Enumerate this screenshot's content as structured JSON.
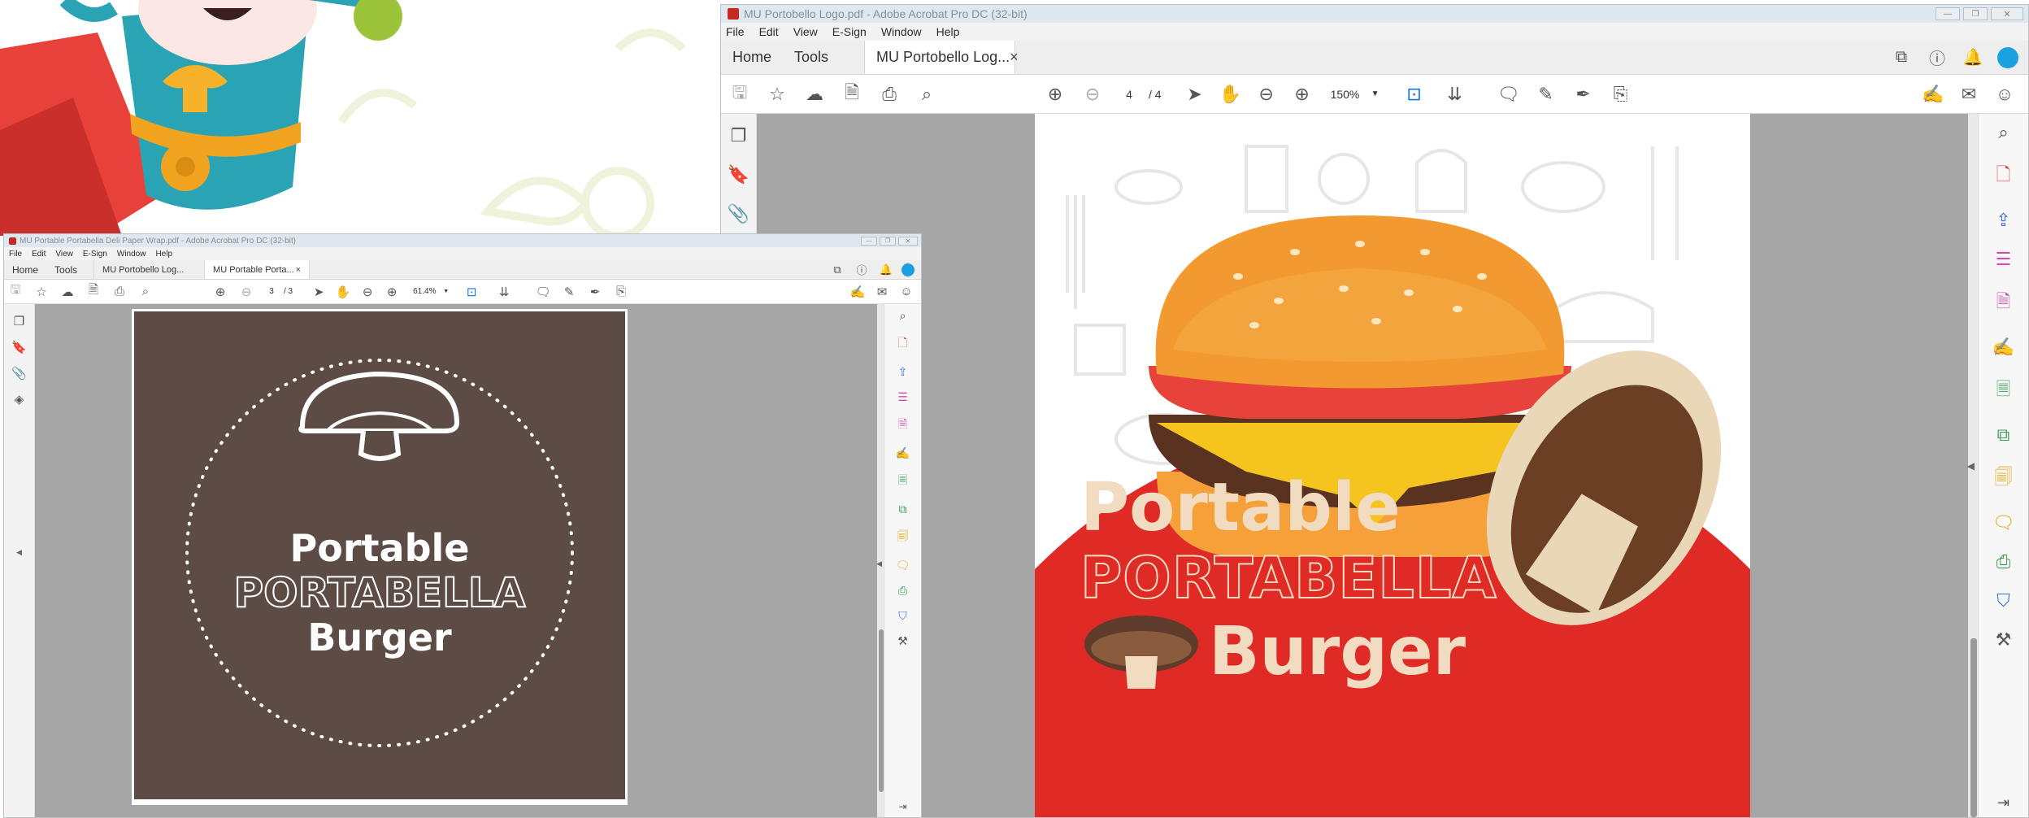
{
  "big_window": {
    "title": "MU Portobello Logo.pdf - Adobe Acrobat Pro DC (32-bit)",
    "menu": [
      "File",
      "Edit",
      "View",
      "E-Sign",
      "Window",
      "Help"
    ],
    "tabs": {
      "home": "Home",
      "tools": "Tools",
      "doc": "MU Portobello Log...",
      "close": "×"
    },
    "page_current": "4",
    "page_total": "/ 4",
    "zoom": "150%",
    "document": {
      "line1": "Portable",
      "line2": "PORTABELLA",
      "line3": "Burger"
    }
  },
  "small_window": {
    "title": "MU Portable Portabella Deli Paper Wrap.pdf - Adobe Acrobat Pro DC (32-bit)",
    "menu": [
      "File",
      "Edit",
      "View",
      "E-Sign",
      "Window",
      "Help"
    ],
    "tabs": {
      "home": "Home",
      "tools": "Tools",
      "doc1": "MU Portobello Log...",
      "doc2": "MU Portable Porta...",
      "close": "×"
    },
    "page_current": "3",
    "page_total": "/ 3",
    "zoom": "61.4%",
    "document": {
      "line1": "Portable",
      "line2": "PORTABELLA",
      "line3": "Burger"
    }
  },
  "colors": {
    "acrobat_blue": "#1473e6",
    "burger_red": "#df2a26",
    "logo_brown": "#5c4c45",
    "cream": "#f1dcc2",
    "avatar": "#1ba1e2"
  },
  "icons": {
    "toolbar": [
      "save-icon",
      "star-icon",
      "cloud-upload-icon",
      "file-share-icon",
      "print-icon",
      "search-zoom-icon",
      "page-up-icon",
      "page-down-icon",
      "select-arrow-icon",
      "hand-icon",
      "zoom-out-icon",
      "zoom-in-icon",
      "fit-page-icon",
      "scroll-mode-icon",
      "comment-icon",
      "highlight-icon",
      "draw-icon",
      "stamp-icon",
      "sign-icon",
      "email-icon",
      "account-icon"
    ]
  }
}
